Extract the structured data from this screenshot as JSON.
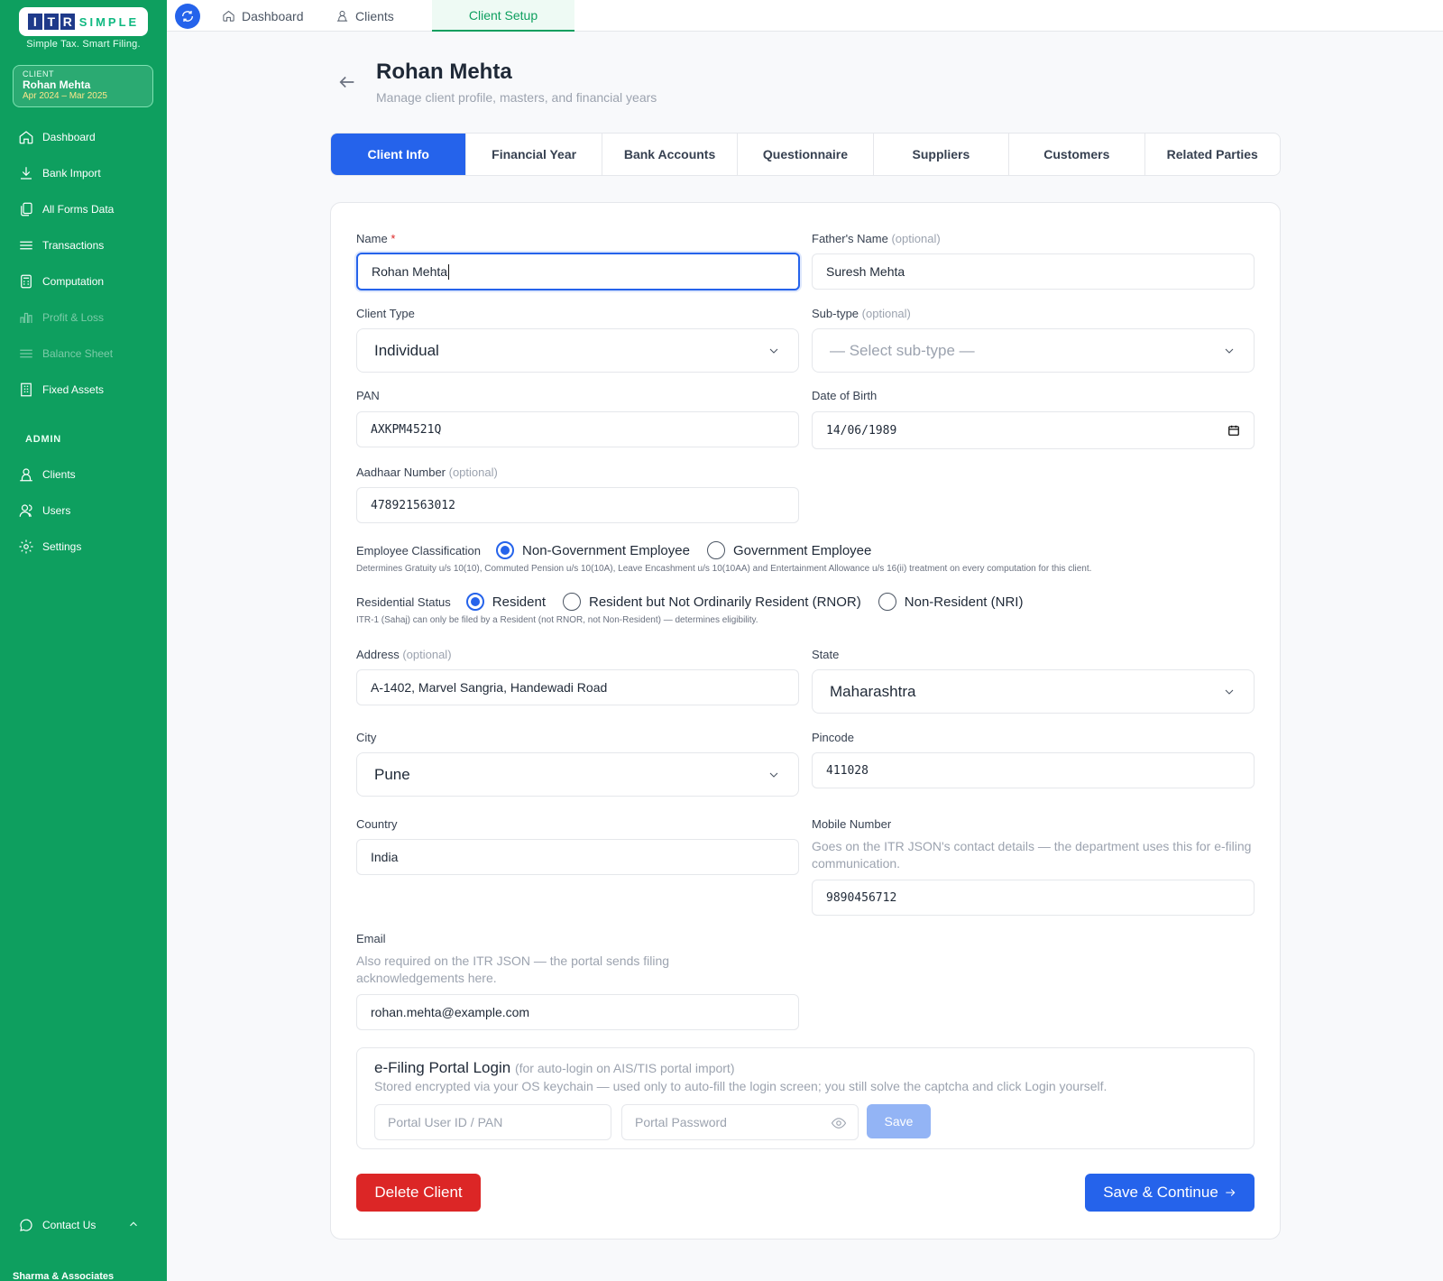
{
  "brand": {
    "logo_letters": [
      "I",
      "T",
      "R"
    ],
    "logo_rest": "SIMPLE",
    "tagline": "Simple Tax. Smart Filing."
  },
  "client_card": {
    "label": "CLIENT",
    "name": "Rohan Mehta",
    "period": "Apr 2024 – Mar 2025"
  },
  "sidebar": {
    "items": [
      {
        "label": "Dashboard",
        "icon": "home-icon"
      },
      {
        "label": "Bank Import",
        "icon": "download-icon"
      },
      {
        "label": "All Forms Data",
        "icon": "copy-icon"
      },
      {
        "label": "Transactions",
        "icon": "list-icon"
      },
      {
        "label": "Computation",
        "icon": "calculator-icon"
      },
      {
        "label": "Profit & Loss",
        "icon": "bar-chart-icon"
      },
      {
        "label": "Balance Sheet",
        "icon": "menu-icon"
      },
      {
        "label": "Fixed Assets",
        "icon": "building-icon"
      }
    ],
    "admin_label": "ADMIN",
    "admin_items": [
      {
        "label": "Clients",
        "icon": "clients-icon"
      },
      {
        "label": "Users",
        "icon": "users-icon"
      },
      {
        "label": "Settings",
        "icon": "gear-icon"
      }
    ],
    "contact": "Contact Us",
    "firm": "Sharma & Associates"
  },
  "topbar": {
    "tabs": [
      "Dashboard",
      "Clients",
      "Client Setup"
    ]
  },
  "header": {
    "title": "Rohan Mehta",
    "subtitle": "Manage client profile, masters, and financial years"
  },
  "tabs": [
    "Client Info",
    "Financial Year",
    "Bank Accounts",
    "Questionnaire",
    "Suppliers",
    "Customers",
    "Related Parties"
  ],
  "form": {
    "name_label": "Name",
    "name_req": "*",
    "name_value": "Rohan Mehta",
    "father_label": "Father's Name",
    "father_value": "Suresh Mehta",
    "optional": "(optional)",
    "client_type_label": "Client Type",
    "client_type_value": "Individual",
    "subtype_label": "Sub-type",
    "subtype_placeholder": "— Select sub-type —",
    "pan_label": "PAN",
    "pan_value": "AXKPM4521Q",
    "dob_label": "Date of Birth",
    "dob_value": "14/06/1989",
    "aadhaar_label": "Aadhaar Number",
    "aadhaar_value": "478921563012",
    "emp_label": "Employee Classification",
    "emp_options": [
      "Non-Government Employee",
      "Government Employee"
    ],
    "emp_hint": "Determines Gratuity u/s 10(10), Commuted Pension u/s 10(10A), Leave Encashment u/s 10(10AA) and Entertainment Allowance u/s 16(ii) treatment on every computation for this client.",
    "res_label": "Residential Status",
    "res_options": [
      "Resident",
      "Resident but Not Ordinarily Resident (RNOR)",
      "Non-Resident (NRI)"
    ],
    "res_hint": "ITR-1 (Sahaj) can only be filed by a Resident (not RNOR, not Non-Resident) — determines eligibility.",
    "address_label": "Address",
    "address_value": "A-1402, Marvel Sangria, Handewadi Road",
    "state_label": "State",
    "state_value": "Maharashtra",
    "city_label": "City",
    "city_value": "Pune",
    "pincode_label": "Pincode",
    "pincode_value": "411028",
    "country_label": "Country",
    "country_value": "India",
    "mobile_label": "Mobile Number",
    "mobile_hint": "Goes on the ITR JSON's contact details — the department uses this for e-filing communication.",
    "mobile_value": "9890456712",
    "email_label": "Email",
    "email_hint": "Also required on the ITR JSON — the portal sends filing acknowledgements here.",
    "email_value": "rohan.mehta@example.com"
  },
  "portal": {
    "title": "e-Filing Portal Login",
    "title_note": "(for auto-login on AIS/TIS portal import)",
    "subtitle": "Stored encrypted via your OS keychain — used only to auto-fill the login screen; you still solve the captcha and click Login yourself.",
    "user_placeholder": "Portal User ID / PAN",
    "password_placeholder": "Portal Password",
    "save_label": "Save"
  },
  "actions": {
    "delete_label": "Delete Client",
    "save_label": "Save & Continue"
  },
  "colors": {
    "sidebar": "#0e9f5f",
    "primary": "#2563eb",
    "danger": "#dc2626"
  }
}
